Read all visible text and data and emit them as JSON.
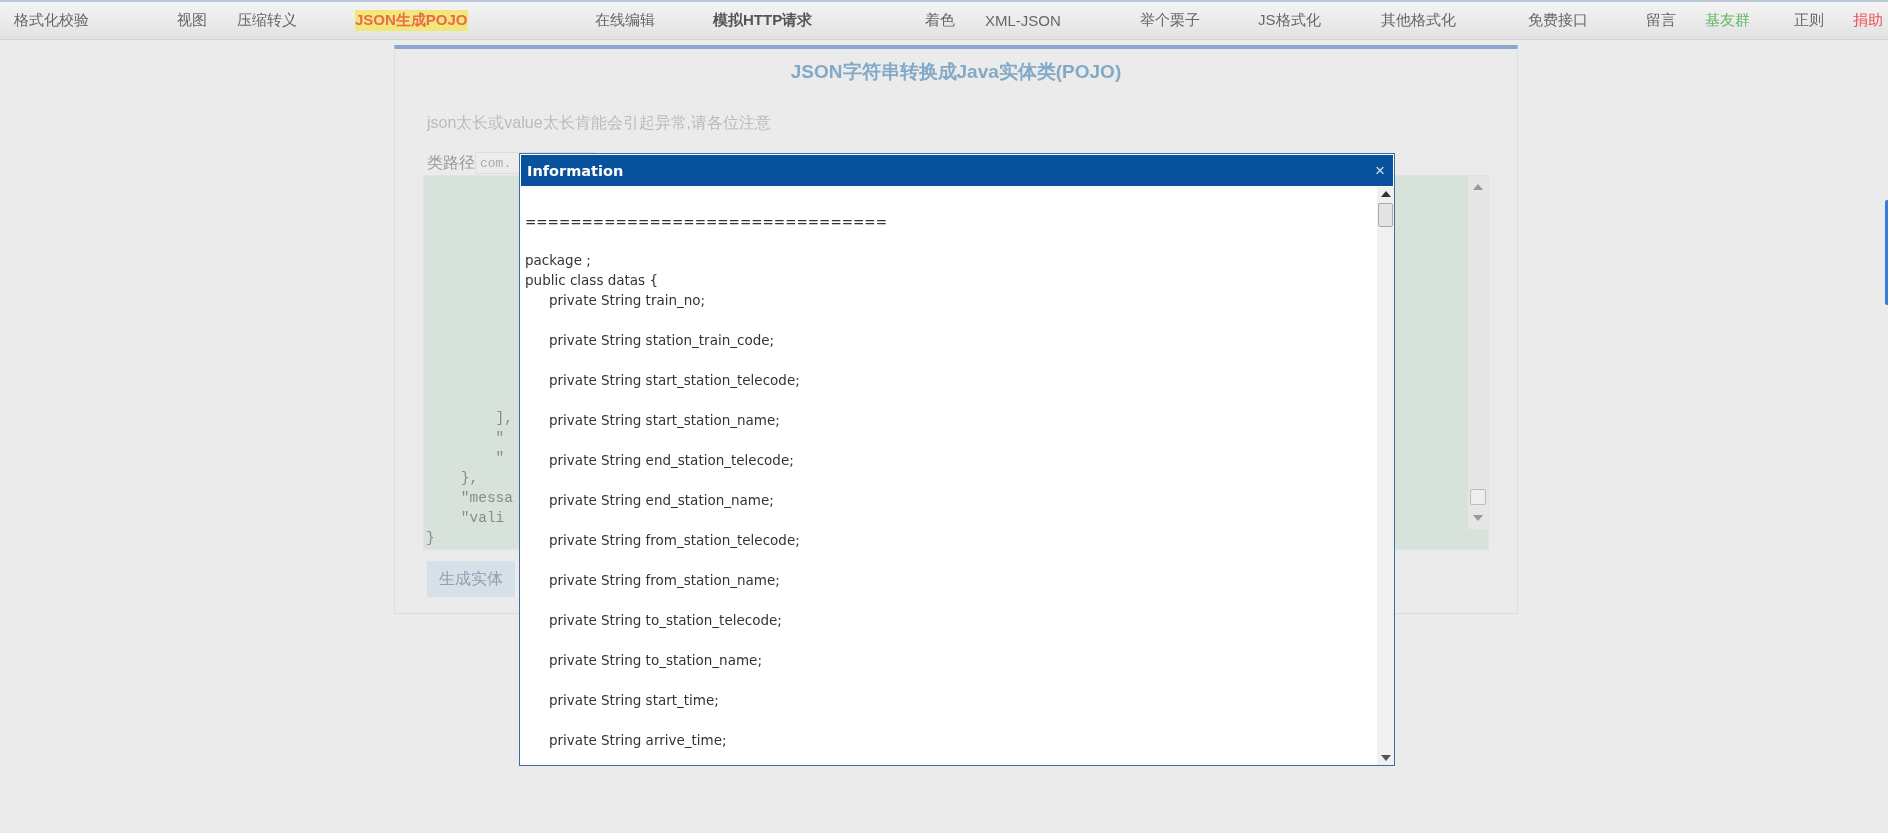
{
  "nav": [
    {
      "label": "格式化校验",
      "selected": false,
      "kind": "plain"
    },
    {
      "label": "视图",
      "selected": false,
      "kind": "plain"
    },
    {
      "label": "压缩转义",
      "selected": false,
      "kind": "plain"
    },
    {
      "label": "JSON生成POJO",
      "selected": true,
      "kind": "plain"
    },
    {
      "label": "在线编辑",
      "selected": false,
      "kind": "plain"
    },
    {
      "label": "模拟HTTP请求",
      "selected": false,
      "kind": "bold"
    },
    {
      "label": "着色",
      "selected": false,
      "kind": "plain"
    },
    {
      "label": "XML-JSON",
      "selected": false,
      "kind": "plain"
    },
    {
      "label": "举个栗子",
      "selected": false,
      "kind": "plain"
    },
    {
      "label": "JS格式化",
      "selected": false,
      "kind": "plain"
    },
    {
      "label": "其他格式化",
      "selected": false,
      "kind": "plain"
    },
    {
      "label": "免费接口",
      "selected": false,
      "kind": "plain"
    },
    {
      "label": "留言",
      "selected": false,
      "kind": "plain"
    },
    {
      "label": "基友群",
      "selected": false,
      "kind": "green"
    },
    {
      "label": "正则",
      "selected": false,
      "kind": "plain"
    },
    {
      "label": "捐助",
      "selected": false,
      "kind": "red"
    }
  ],
  "page": {
    "title": "JSON字符串转换成Java实体类(POJO)",
    "notice": "json太长或value太长肯能会引起异常,请各位注意",
    "class_path": {
      "label": "类路径",
      "value": "com."
    },
    "code_lines": [
      "        ],",
      "        \"",
      "        \"",
      "    },",
      "    \"messa",
      "    \"vali",
      "}"
    ],
    "generate_button": "生成实体"
  },
  "dialog": {
    "title": "Information",
    "close": "×",
    "separator": "================================",
    "package": "package ;",
    "class_decl": "public class datas {",
    "fields": [
      "private String train_no;",
      "private String station_train_code;",
      "private String start_station_telecode;",
      "private String start_station_name;",
      "private String end_station_telecode;",
      "private String end_station_name;",
      "private String from_station_telecode;",
      "private String from_station_name;",
      "private String to_station_telecode;",
      "private String to_station_name;",
      "private String start_time;",
      "private String arrive_time;"
    ]
  }
}
